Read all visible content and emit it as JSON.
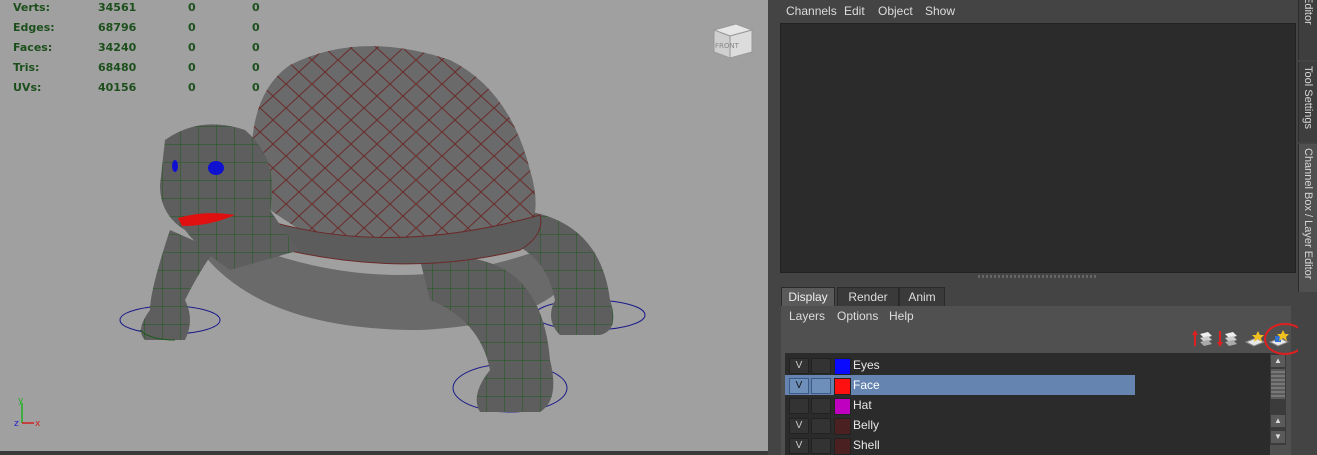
{
  "hud": {
    "rows": [
      {
        "label": "Verts:",
        "total": "34561",
        "sel": "0",
        "comp": "0"
      },
      {
        "label": "Edges:",
        "total": "68796",
        "sel": "0",
        "comp": "0"
      },
      {
        "label": "Faces:",
        "total": "34240",
        "sel": "0",
        "comp": "0"
      },
      {
        "label": "Tris:",
        "total": "68480",
        "sel": "0",
        "comp": "0"
      },
      {
        "label": "UVs:",
        "total": "40156",
        "sel": "0",
        "comp": "0"
      }
    ]
  },
  "viewcube": {
    "label": "FRONT"
  },
  "axes": {
    "x": "x",
    "y": "y",
    "z": "z"
  },
  "channel_menu": [
    "Channels",
    "Edit",
    "Object",
    "Show"
  ],
  "tabs": [
    {
      "label": "Display",
      "active": true
    },
    {
      "label": "Render",
      "active": false
    },
    {
      "label": "Anim",
      "active": false
    }
  ],
  "layer_menu": [
    "Layers",
    "Options",
    "Help"
  ],
  "layer_tools": [
    "move-layer-up-icon",
    "move-layer-down-icon",
    "create-empty-layer-icon",
    "create-layer-from-selected-icon"
  ],
  "layers": [
    {
      "v": "V",
      "name": "Eyes",
      "color": "#0a0aff",
      "selected": false
    },
    {
      "v": "V",
      "name": "Face",
      "color": "#ff1010",
      "selected": true
    },
    {
      "v": "",
      "name": "Hat",
      "color": "#c000c0",
      "selected": false
    },
    {
      "v": "V",
      "name": "Belly",
      "color": "#4a2020",
      "selected": false
    },
    {
      "v": "V",
      "name": "Shell",
      "color": "#4a2020",
      "selected": false
    }
  ],
  "side_tabs": [
    {
      "label": "Attribute Editor",
      "active": false
    },
    {
      "label": "Tool Settings",
      "active": false
    },
    {
      "label": "Channel Box / Layer Editor",
      "active": true
    }
  ],
  "colors": {
    "viewport_bg": "#a0a0a0",
    "hud_text": "#1c4f1c",
    "selection": "#6585b0",
    "annotation": "#e02020"
  }
}
